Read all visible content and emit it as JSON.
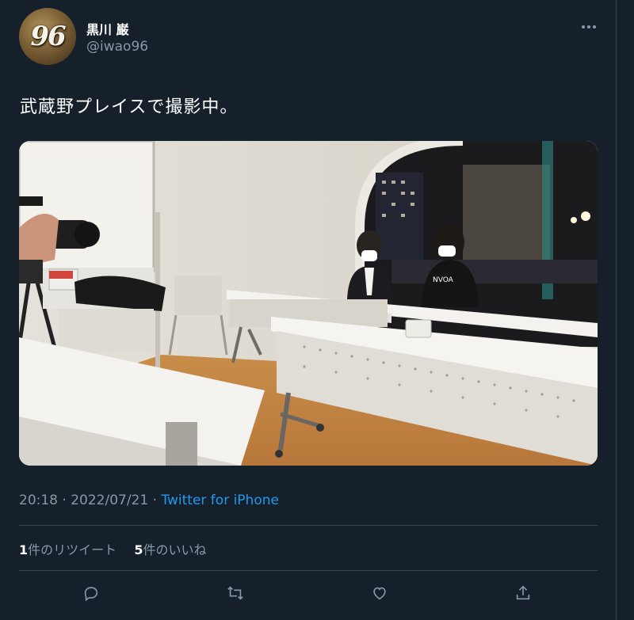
{
  "user": {
    "avatar_text": "96",
    "display_name": "黒川 巌",
    "handle": "@iwao96"
  },
  "tweet": {
    "text": "武蔵野プレイスで撮影中。",
    "time": "20:18",
    "date": "2022/07/21",
    "separator": "·",
    "source": "Twitter for iPhone"
  },
  "stats": {
    "retweet_count": "1",
    "retweet_label": "件のリツイート",
    "like_count": "5",
    "like_label": "件のいいね"
  },
  "icons": {
    "more": "more-horizontal-icon",
    "reply": "reply-icon",
    "retweet": "retweet-icon",
    "like": "like-icon",
    "share": "share-icon"
  },
  "colors": {
    "background": "#15202b",
    "secondary_text": "#8899a6",
    "link": "#1d9bf0",
    "divider": "#38444d"
  }
}
